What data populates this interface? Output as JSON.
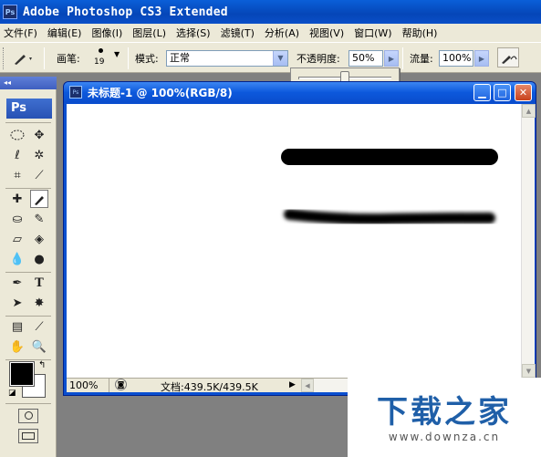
{
  "app": {
    "title": "Adobe Photoshop CS3 Extended",
    "icon_label": "Ps"
  },
  "menu": [
    "文件(F)",
    "编辑(E)",
    "图像(I)",
    "图层(L)",
    "选择(S)",
    "滤镜(T)",
    "分析(A)",
    "视图(V)",
    "窗口(W)",
    "帮助(H)"
  ],
  "options": {
    "brush_label": "画笔:",
    "brush_size": "19",
    "mode_label": "模式:",
    "mode_value": "正常",
    "opacity_label": "不透明度:",
    "opacity_value": "50%",
    "opacity_slider": 0.5,
    "flow_label": "流量:",
    "flow_value": "100%"
  },
  "palette": {
    "logo": "Ps"
  },
  "document": {
    "title": "未标题-1 @ 100%(RGB/8)",
    "zoom": "100%",
    "doc_info": "文档:439.5K/439.5K"
  },
  "watermark": {
    "main": "下载之家",
    "url": "www.downza.cn"
  }
}
